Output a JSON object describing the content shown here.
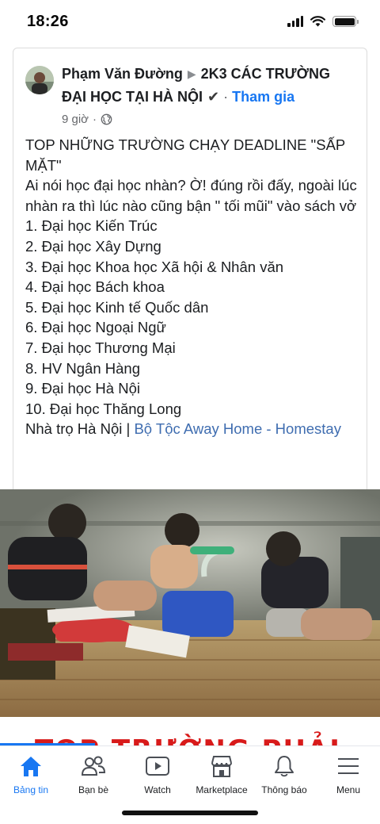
{
  "status_bar": {
    "time": "18:26"
  },
  "post": {
    "author": "Phạm Văn Đường",
    "group": "2K3 CÁC TRƯỜNG",
    "group_line2": "ĐẠI HỌC TẠI HÀ NỘI",
    "join_label": "Tham gia",
    "time_ago": "9 giờ",
    "dot": "·",
    "text": {
      "line1": "TOP NHỮNG TRƯỜNG CHẠY DEADLINE \"SẤP MẶT\"",
      "line2": "Ai nói học đại học nhàn? Ờ! đúng rồi đấy, ngoài lúc nhàn ra thì lúc nào cũng bận \" tối mũi\" vào sách vở",
      "list": [
        "1. Đại học Kiến Trúc",
        "2. Đại học Xây Dựng",
        "3. Đại học Khoa học Xã hội & Nhân văn",
        "4. Đại học Bách khoa",
        "5. Đại học Kinh tế Quốc dân",
        "6. Đại học Ngoại Ngữ",
        "7. Đại học Thương Mại",
        "8. HV Ngân Hàng",
        "9. Đại học Hà Nội",
        "10. Đại học Thăng Long"
      ],
      "footer_prefix": "Nhà trọ Hà Nội | ",
      "footer_link": "Bộ Tộc Away Home - Homestay"
    }
  },
  "banner": {
    "text": "TOP TRƯỜNG PHẢI"
  },
  "nav": {
    "items": [
      {
        "label": "Bảng tin",
        "icon": "home-icon"
      },
      {
        "label": "Bạn bè",
        "icon": "friends-icon"
      },
      {
        "label": "Watch",
        "icon": "watch-icon"
      },
      {
        "label": "Marketplace",
        "icon": "marketplace-icon"
      },
      {
        "label": "Thông báo",
        "icon": "bell-icon"
      },
      {
        "label": "Menu",
        "icon": "menu-icon"
      }
    ]
  },
  "colors": {
    "accent": "#1877f2",
    "banner_red": "#d81a1a",
    "link": "#3f6db0"
  }
}
